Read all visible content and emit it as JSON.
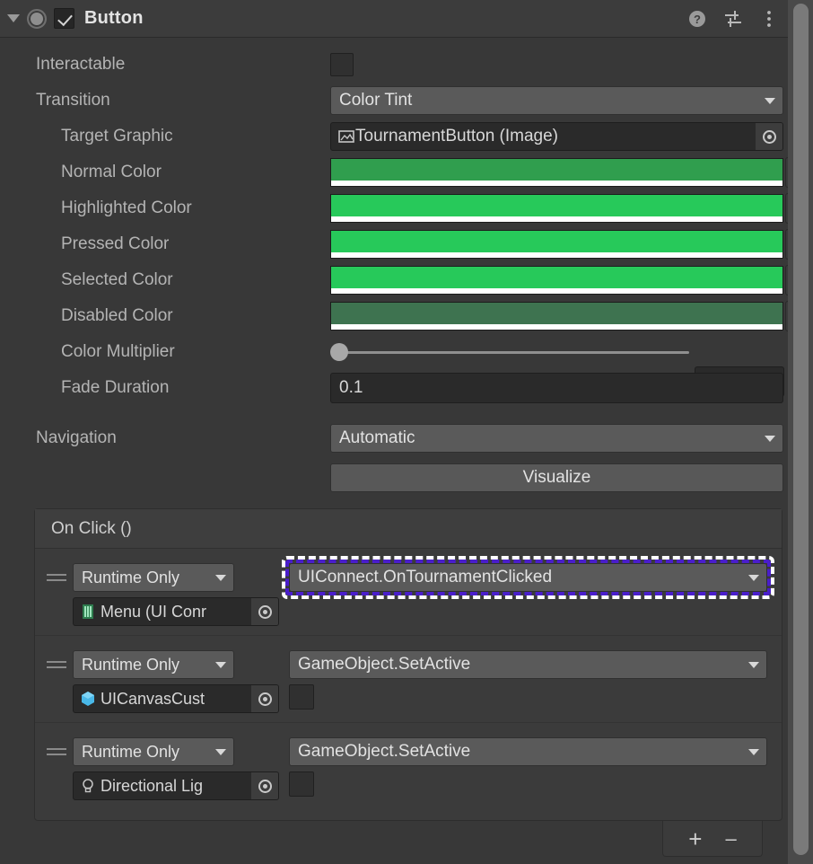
{
  "header": {
    "title": "Button",
    "enabled_checkbox": true,
    "foldout_expanded": true,
    "icons": [
      "help-icon",
      "preset-icon",
      "more-menu-icon"
    ]
  },
  "properties": {
    "interactable": {
      "label": "Interactable",
      "value": false
    },
    "transition": {
      "label": "Transition",
      "value": "Color Tint"
    },
    "target_graphic": {
      "label": "Target Graphic",
      "value": "TournamentButton (Image)"
    },
    "normal_color": {
      "label": "Normal Color",
      "value": "#309E4E"
    },
    "highlighted_color": {
      "label": "Highlighted Color",
      "value": "#27C95A"
    },
    "pressed_color": {
      "label": "Pressed Color",
      "value": "#27C95A"
    },
    "selected_color": {
      "label": "Selected Color",
      "value": "#27C95A"
    },
    "disabled_color": {
      "label": "Disabled Color",
      "value": "#3E7350"
    },
    "color_multiplier": {
      "label": "Color Multiplier",
      "value": "1"
    },
    "fade_duration": {
      "label": "Fade Duration",
      "value": "0.1"
    },
    "navigation": {
      "label": "Navigation",
      "value": "Automatic"
    },
    "visualize": {
      "label": "Visualize"
    }
  },
  "on_click": {
    "title": "On Click ()",
    "events": [
      {
        "mode": "Runtime Only",
        "function": "UIConnect.OnTournamentClicked",
        "object": "Menu (UI Conr",
        "object_icon": "script-icon",
        "highlighted": true,
        "has_bool_arg": false
      },
      {
        "mode": "Runtime Only",
        "function": "GameObject.SetActive",
        "object": "UICanvasCust",
        "object_icon": "prefab-icon",
        "highlighted": false,
        "has_bool_arg": true,
        "bool_arg": false
      },
      {
        "mode": "Runtime Only",
        "function": "GameObject.SetActive",
        "object": "Directional Lig",
        "object_icon": "light-icon",
        "highlighted": false,
        "has_bool_arg": true,
        "bool_arg": false
      }
    ],
    "add_label": "+",
    "remove_label": "–"
  },
  "colors": {
    "panel_bg": "#383838",
    "header_bg": "#3c3c3c",
    "field_dark": "#2a2a2a",
    "field_light": "#5a5a5a",
    "highlight_purple": "#4a1ecb",
    "highlight_white": "#ffffff",
    "text": "#b4b4b4"
  }
}
